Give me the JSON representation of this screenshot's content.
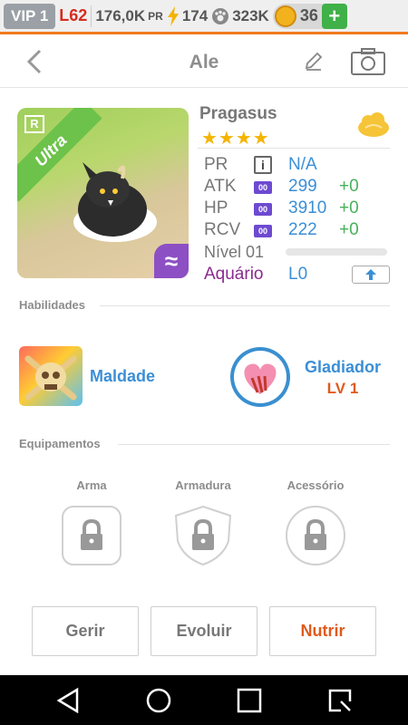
{
  "status": {
    "vip": "VIP 1",
    "level": "L62",
    "pr_value": "176,0K",
    "pr_label": "PR",
    "energy": "174",
    "paw": "323K",
    "coins": "36",
    "plus": "+"
  },
  "header": {
    "title": "Ale"
  },
  "pet": {
    "name": "Pragasus",
    "stars": "★★★★",
    "rarity_badge": "R",
    "ribbon": "Ultra",
    "element_symbol": "≈",
    "pr_key": "PR",
    "pr_value": "N/A",
    "info_icon": "i",
    "stats": [
      {
        "key": "ATK",
        "badge": "00",
        "value": "299",
        "bonus": "+0"
      },
      {
        "key": "HP",
        "badge": "00",
        "value": "3910",
        "bonus": "+0"
      },
      {
        "key": "RCV",
        "badge": "00",
        "value": "222",
        "bonus": "+0"
      }
    ],
    "level_label": "Nível 01",
    "level_progress": 0,
    "aquarium_label": "Aquário",
    "aquarium_value": "L0"
  },
  "skills": {
    "section": "Habilidades",
    "items": [
      {
        "label": "Maldade"
      },
      {
        "label": "Gladiador",
        "level": "LV 1"
      }
    ]
  },
  "equipment": {
    "section": "Equipamentos",
    "slots": [
      "Arma",
      "Armadura",
      "Acessório"
    ]
  },
  "actions": {
    "manage": "Gerir",
    "evolve": "Evoluir",
    "feed": "Nutrir"
  },
  "colors": {
    "accent": "#f07a1c",
    "link": "#3b8fd6",
    "feed": "#e05a1c",
    "bonus": "#47b05c"
  }
}
